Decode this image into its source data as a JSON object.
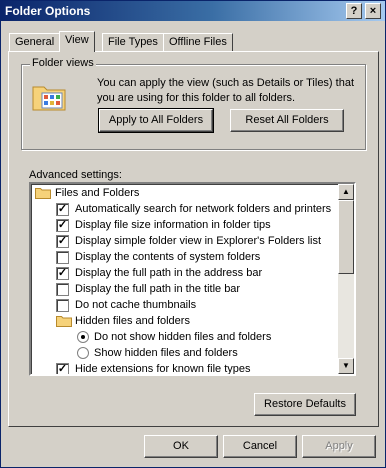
{
  "window": {
    "title": "Folder Options",
    "help_label": "?",
    "close_label": "×"
  },
  "tabs": [
    {
      "label": "General"
    },
    {
      "label": "View"
    },
    {
      "label": "File Types"
    },
    {
      "label": "Offline Files"
    }
  ],
  "folder_views": {
    "title": "Folder views",
    "description": "You can apply the view (such as Details or Tiles) that you are using for this folder to all folders.",
    "apply_label": "Apply to All Folders",
    "reset_label": "Reset All Folders"
  },
  "advanced": {
    "label": "Advanced settings:",
    "items": [
      {
        "kind": "folder",
        "label": "Files and Folders"
      },
      {
        "kind": "checkbox",
        "checked": true,
        "label": "Automatically search for network folders and printers"
      },
      {
        "kind": "checkbox",
        "checked": true,
        "label": "Display file size information in folder tips"
      },
      {
        "kind": "checkbox",
        "checked": true,
        "label": "Display simple folder view in Explorer's Folders list"
      },
      {
        "kind": "checkbox",
        "checked": false,
        "label": "Display the contents of system folders"
      },
      {
        "kind": "checkbox",
        "checked": true,
        "label": "Display the full path in the address bar"
      },
      {
        "kind": "checkbox",
        "checked": false,
        "label": "Display the full path in the title bar"
      },
      {
        "kind": "checkbox",
        "checked": false,
        "label": "Do not cache thumbnails"
      },
      {
        "kind": "folder",
        "label": "Hidden files and folders"
      },
      {
        "kind": "radio",
        "checked": true,
        "label": "Do not show hidden files and folders"
      },
      {
        "kind": "radio",
        "checked": false,
        "label": "Show hidden files and folders"
      },
      {
        "kind": "checkbox",
        "checked": true,
        "label": "Hide extensions for known file types"
      }
    ],
    "restore_label": "Restore Defaults"
  },
  "footer": {
    "ok_label": "OK",
    "cancel_label": "Cancel",
    "apply_label": "Apply"
  },
  "colors": {
    "titlebar": "#0a246a",
    "face": "#d4d0c8",
    "folder": "#f6d27a"
  },
  "icons": {
    "folder_views": "folder-tiles-icon",
    "tree_folder": "folder-icon",
    "scroll_up": "up-arrow-icon",
    "scroll_down": "down-arrow-icon"
  }
}
